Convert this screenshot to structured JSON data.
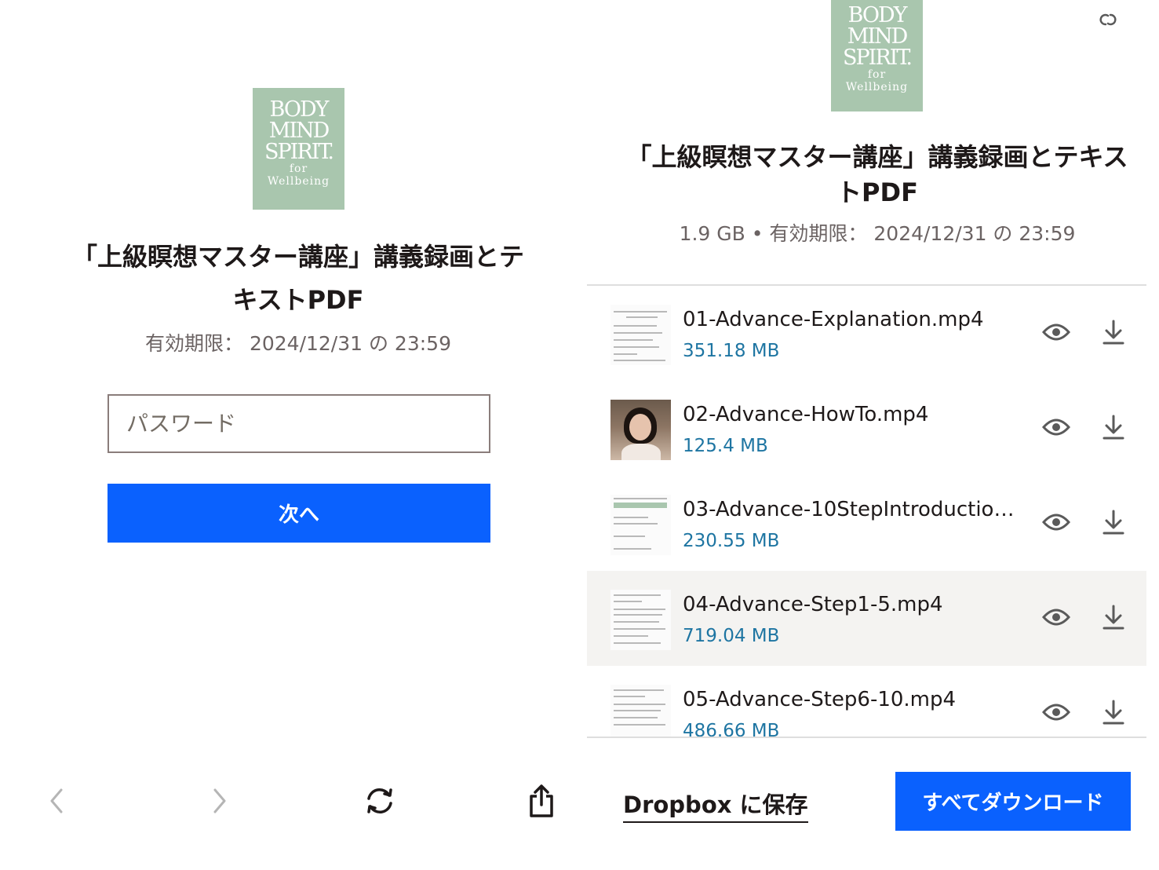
{
  "logo": {
    "line1": "BODY",
    "line2": "MIND",
    "line3": "SPIRIT.",
    "line4": "for",
    "line5": "Wellbeing",
    "color": "#a9c6ae"
  },
  "login": {
    "title": "「上級瞑想マスター講座」講義録画とテキストPDF",
    "expiry": "有効期限： 2024/12/31 の 23:59",
    "password_placeholder": "パスワード",
    "next_label": "次へ",
    "button_color": "#0a61fe"
  },
  "browser": {
    "back_icon": "chevron-left-icon",
    "forward_icon": "chevron-right-icon",
    "reload_icon": "reload-icon",
    "share_icon": "share-icon"
  },
  "share": {
    "title": "「上級瞑想マスター講座」講義録画とテキストPDF",
    "meta": "1.9 GB • 有効期限： 2024/12/31 の 23:59",
    "files": [
      {
        "name": "01-Advance-Explanation.mp4",
        "size": "351.18 MB"
      },
      {
        "name": "02-Advance-HowTo.mp4",
        "size": "125.4 MB"
      },
      {
        "name": "03-Advance-10StepIntroduction...",
        "size": "230.55 MB"
      },
      {
        "name": "04-Advance-Step1-5.mp4",
        "size": "719.04 MB"
      },
      {
        "name": "05-Advance-Step6-10.mp4",
        "size": "486.66 MB"
      }
    ],
    "save_label": "Dropbox に保存",
    "download_all_label": "すべてダウンロード",
    "size_color": "#1e75a2"
  }
}
